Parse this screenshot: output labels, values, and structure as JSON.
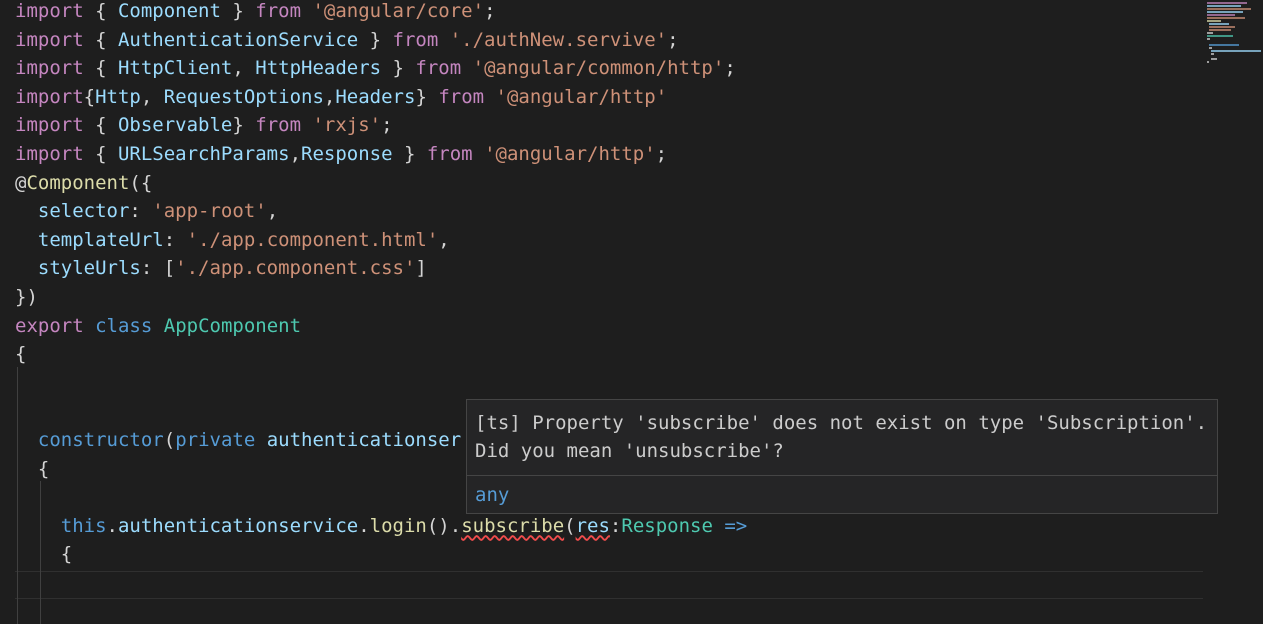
{
  "editor": {
    "lines": [
      [
        [
          "import",
          "kw"
        ],
        [
          " { ",
          "pun"
        ],
        [
          "Component",
          "id"
        ],
        [
          " } ",
          "pun"
        ],
        [
          "from",
          "kw"
        ],
        [
          " ",
          "pun"
        ],
        [
          "'@angular/core'",
          "str"
        ],
        [
          ";",
          "pun"
        ]
      ],
      [
        [
          "import",
          "kw"
        ],
        [
          " { ",
          "pun"
        ],
        [
          "AuthenticationService",
          "id"
        ],
        [
          " } ",
          "pun"
        ],
        [
          "from",
          "kw"
        ],
        [
          " ",
          "pun"
        ],
        [
          "'./authNew.servive'",
          "str"
        ],
        [
          ";",
          "pun"
        ]
      ],
      [
        [
          "import",
          "kw"
        ],
        [
          " { ",
          "pun"
        ],
        [
          "HttpClient",
          "id"
        ],
        [
          ", ",
          "pun"
        ],
        [
          "HttpHeaders",
          "id"
        ],
        [
          " } ",
          "pun"
        ],
        [
          "from",
          "kw"
        ],
        [
          " ",
          "pun"
        ],
        [
          "'@angular/common/http'",
          "str"
        ],
        [
          ";",
          "pun"
        ]
      ],
      [
        [
          "import",
          "kw"
        ],
        [
          "{",
          "pun"
        ],
        [
          "Http",
          "id"
        ],
        [
          ", ",
          "pun"
        ],
        [
          "RequestOptions",
          "id"
        ],
        [
          ",",
          "pun"
        ],
        [
          "Headers",
          "id"
        ],
        [
          "} ",
          "pun"
        ],
        [
          "from",
          "kw"
        ],
        [
          " ",
          "pun"
        ],
        [
          "'@angular/http'",
          "str"
        ]
      ],
      [
        [
          "import",
          "kw"
        ],
        [
          " { ",
          "pun"
        ],
        [
          "Observable",
          "id"
        ],
        [
          "} ",
          "pun"
        ],
        [
          "from",
          "kw"
        ],
        [
          " ",
          "pun"
        ],
        [
          "'rxjs'",
          "str"
        ],
        [
          ";",
          "pun"
        ]
      ],
      [
        [
          "import",
          "kw"
        ],
        [
          " { ",
          "pun"
        ],
        [
          "URLSearchParams",
          "id"
        ],
        [
          ",",
          "pun"
        ],
        [
          "Response",
          "id"
        ],
        [
          " } ",
          "pun"
        ],
        [
          "from",
          "kw"
        ],
        [
          " ",
          "pun"
        ],
        [
          "'@angular/http'",
          "str"
        ],
        [
          ";",
          "pun"
        ]
      ],
      [
        [
          "@",
          "pun"
        ],
        [
          "Component",
          "fn"
        ],
        [
          "({",
          "pun"
        ]
      ],
      [
        [
          "  ",
          "pun"
        ],
        [
          "selector",
          "id"
        ],
        [
          ": ",
          "pun"
        ],
        [
          "'app-root'",
          "str"
        ],
        [
          ",",
          "pun"
        ]
      ],
      [
        [
          "  ",
          "pun"
        ],
        [
          "templateUrl",
          "id"
        ],
        [
          ": ",
          "pun"
        ],
        [
          "'./app.component.html'",
          "str"
        ],
        [
          ",",
          "pun"
        ]
      ],
      [
        [
          "  ",
          "pun"
        ],
        [
          "styleUrls",
          "id"
        ],
        [
          ": [",
          "pun"
        ],
        [
          "'./app.component.css'",
          "str"
        ],
        [
          "]",
          "pun"
        ]
      ],
      [
        [
          "})",
          "pun"
        ]
      ],
      [
        [
          "export",
          "kw"
        ],
        [
          " ",
          "pun"
        ],
        [
          "class",
          "sk"
        ],
        [
          " ",
          "pun"
        ],
        [
          "AppComponent",
          "cls"
        ]
      ],
      [
        [
          "{",
          "pun"
        ]
      ],
      [],
      [],
      [
        [
          "  ",
          "pun"
        ],
        [
          "constructor",
          "sk"
        ],
        [
          "(",
          "pun"
        ],
        [
          "private",
          "sk"
        ],
        [
          " ",
          "pun"
        ],
        [
          "authenticationser",
          "id"
        ]
      ],
      [
        [
          "  {",
          "pun"
        ]
      ],
      [],
      [
        [
          "    ",
          "pun"
        ],
        [
          "this",
          "sk"
        ],
        [
          ".",
          "pun"
        ],
        [
          "authenticationservice",
          "id"
        ],
        [
          ".",
          "pun"
        ],
        [
          "login",
          "fn"
        ],
        [
          "().",
          "pun"
        ],
        [
          "subscribe",
          "fn",
          "err"
        ],
        [
          "(",
          "pun"
        ],
        [
          "res",
          "id",
          "err"
        ],
        [
          ":",
          "pun"
        ],
        [
          "Response",
          "cls"
        ],
        [
          " ",
          "pun"
        ],
        [
          "=>",
          "sk"
        ]
      ],
      [
        [
          "    {",
          "pun"
        ]
      ],
      [],
      [],
      [
        [
          "    }) ;",
          "pun"
        ]
      ]
    ]
  },
  "hover": {
    "message": "[ts] Property 'subscribe' does not exist on type 'Subscription'. Did you mean 'unsubscribe'?",
    "type": "any"
  },
  "colors": {
    "background": "#1e1e1e",
    "keyword": "#c586c0",
    "storage": "#569cd6",
    "variable": "#9cdcfe",
    "function": "#dcdcaa",
    "string": "#ce9178",
    "class": "#4ec9b0",
    "error": "#f14c4c"
  }
}
